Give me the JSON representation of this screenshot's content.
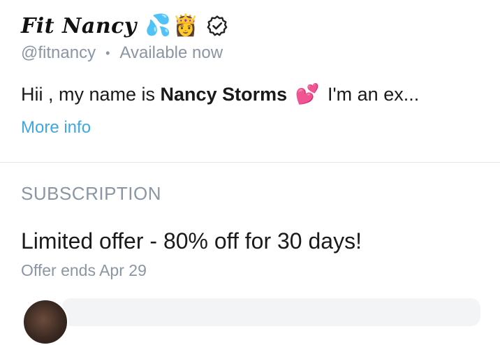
{
  "profile": {
    "display_name": "Fit Nancy",
    "emoji_1": "💦",
    "emoji_2": "👸",
    "username": "@fitnancy",
    "separator": "•",
    "availability": "Available now",
    "bio_prefix": "Hii , my name is ",
    "bio_name": "Nancy Storms",
    "bio_heart": "💕",
    "bio_suffix": " I'm an ex...",
    "more_info_label": "More info",
    "icons": {
      "verified": "verified-badge-icon"
    }
  },
  "subscription": {
    "section_title": "SUBSCRIPTION",
    "offer_title": "Limited offer - 80% off for 30 days!",
    "offer_ends": "Offer ends Apr 29"
  },
  "colors": {
    "accent_link": "#3ea8df",
    "muted_text": "#8a96a3",
    "divider": "#e3e6ea"
  }
}
